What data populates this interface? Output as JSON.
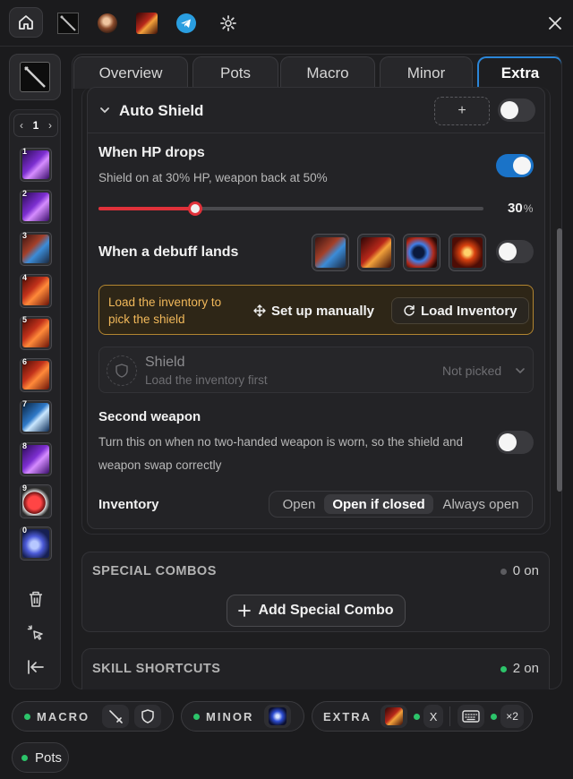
{
  "tabs": [
    "Overview",
    "Pots",
    "Macro",
    "Minor",
    "Extra"
  ],
  "pager": {
    "prev": "‹",
    "page": "1",
    "next": "›"
  },
  "slots": [
    "1",
    "2",
    "3",
    "4",
    "5",
    "6",
    "7",
    "8",
    "9",
    "0"
  ],
  "auto_shield": {
    "title": "Auto Shield",
    "add_label": "+",
    "enabled": false,
    "hp": {
      "title": "When HP drops",
      "description": "Shield on at 30% HP, weapon back at 50%",
      "enabled": true,
      "value": "30",
      "unit": "%",
      "fraction": 0.25
    },
    "debuff": {
      "title": "When a debuff lands",
      "enabled": false
    },
    "warning": {
      "message": "Load the inventory to pick the shield",
      "setup_label": "Set up manually",
      "load_label": "Load Inventory"
    },
    "shield": {
      "label": "Shield",
      "hint": "Load the inventory first",
      "status": "Not picked"
    },
    "second_weapon": {
      "title": "Second weapon",
      "description_line1": "Turn this on when no two-handed weapon is worn, so the shield and",
      "description_line2": "weapon swap correctly",
      "enabled": false
    },
    "inventory": {
      "label": "Inventory",
      "options": [
        "Open",
        "Open if closed",
        "Always open"
      ],
      "selected": "Open if closed"
    }
  },
  "special_combos": {
    "title": "SPECIAL COMBOS",
    "status": "0 on",
    "add_label": "Add Special Combo"
  },
  "skill_shortcuts": {
    "title": "SKILL SHORTCUTS",
    "status": "2 on"
  },
  "chips": {
    "macro": "MACRO",
    "minor": "MINOR",
    "extra": "EXTRA",
    "extra_key": "X",
    "keyboard_count": "×2",
    "pots": "Pots"
  },
  "colors": {
    "accent": "#2b86d8",
    "toggle_on": "#1a73c8",
    "slider": "#e0313a",
    "warning": "#f1b85a",
    "status_on": "#2cc46a"
  }
}
